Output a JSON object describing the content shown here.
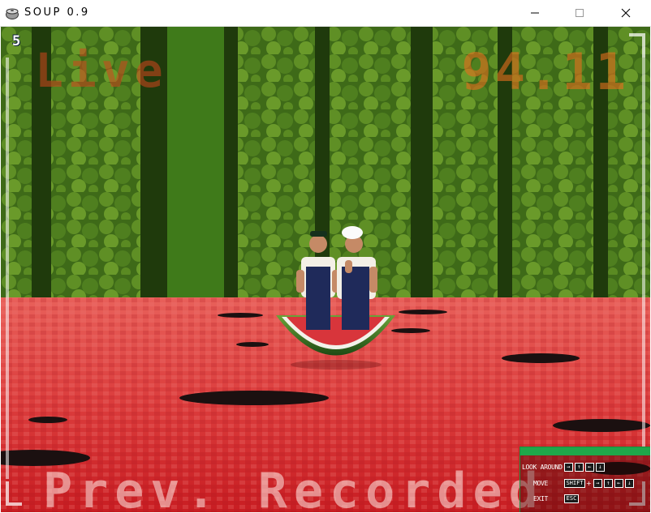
{
  "window": {
    "title": "SOUP 0.9",
    "icon": "soup-pot-icon",
    "buttons": [
      "minimize-icon",
      "maximize-icon",
      "close-icon"
    ]
  },
  "hud": {
    "frame_counter": "5",
    "live_label": "Live",
    "frequency": "94.11",
    "status": "Prev. Recorded"
  },
  "controls": {
    "look_around": {
      "label": "LOOK AROUND",
      "keys": [
        "→",
        "↑",
        "←",
        "↓"
      ]
    },
    "move": {
      "label": "MOVE",
      "modifier": "SHIFT",
      "plus": "+",
      "keys": [
        "→",
        "↑",
        "←",
        "↓"
      ]
    },
    "exit": {
      "label": "EXIT",
      "key": "ESC"
    }
  },
  "scene": {
    "background": "watermarlon rind stripes",
    "floor_color": "#d63a3a",
    "rind_dark": "#1f3a0c",
    "rind_light": "#4d7d1c",
    "accent": "#1fa84a"
  }
}
